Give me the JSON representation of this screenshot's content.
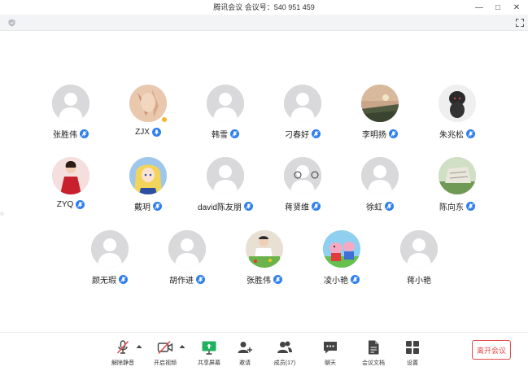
{
  "window": {
    "title": "腾讯会议 会议号：540 951 459",
    "minimize": "—",
    "maximize": "□",
    "close": "✕"
  },
  "participants": [
    {
      "name": "张胜伟",
      "avatar": "default-avatar",
      "mic": "muted"
    },
    {
      "name": "ZJX",
      "avatar": "photo-avatar",
      "mic": "active",
      "host": true
    },
    {
      "name": "韩雪",
      "avatar": "default-avatar",
      "mic": "muted"
    },
    {
      "name": "刁春好",
      "avatar": "default-avatar",
      "mic": "muted"
    },
    {
      "name": "李明扬",
      "avatar": "photo-avatar",
      "mic": "muted"
    },
    {
      "name": "朱兆松",
      "avatar": "photo-avatar",
      "mic": "muted"
    },
    {
      "name": "ZYQ",
      "avatar": "photo-avatar",
      "mic": "muted"
    },
    {
      "name": "戴玥",
      "avatar": "photo-avatar",
      "mic": "muted"
    },
    {
      "name": "david陈友朋",
      "avatar": "default-avatar",
      "mic": "muted"
    },
    {
      "name": "蒋贤维",
      "avatar": "default-avatar",
      "mic": "muted"
    },
    {
      "name": "徐虹",
      "avatar": "default-avatar",
      "mic": "muted"
    },
    {
      "name": "陈向东",
      "avatar": "photo-avatar",
      "mic": "muted"
    },
    {
      "name": "颜无瑕",
      "avatar": "default-avatar",
      "mic": "muted"
    },
    {
      "name": "胡作进",
      "avatar": "default-avatar",
      "mic": "muted"
    },
    {
      "name": "张胜伟",
      "avatar": "photo-avatar",
      "mic": "muted"
    },
    {
      "name": "凌小艳",
      "avatar": "photo-avatar",
      "mic": "muted"
    },
    {
      "name": "蒋小艳",
      "avatar": "default-avatar",
      "mic": "none"
    }
  ],
  "toolbar": {
    "unmute": "解除静音",
    "start_video": "开启视频",
    "share_screen": "共享屏幕",
    "invite": "邀请",
    "members": "成员(17)",
    "chat": "聊天",
    "documents": "会议文档",
    "settings": "设置",
    "leave": "离开会议"
  },
  "colors": {
    "accent": "#2f7ff0",
    "leave": "#e34d4d",
    "share_green": "#1fb160",
    "host_badge": "#f6b52c",
    "avatar_default": "#d9d9db"
  }
}
